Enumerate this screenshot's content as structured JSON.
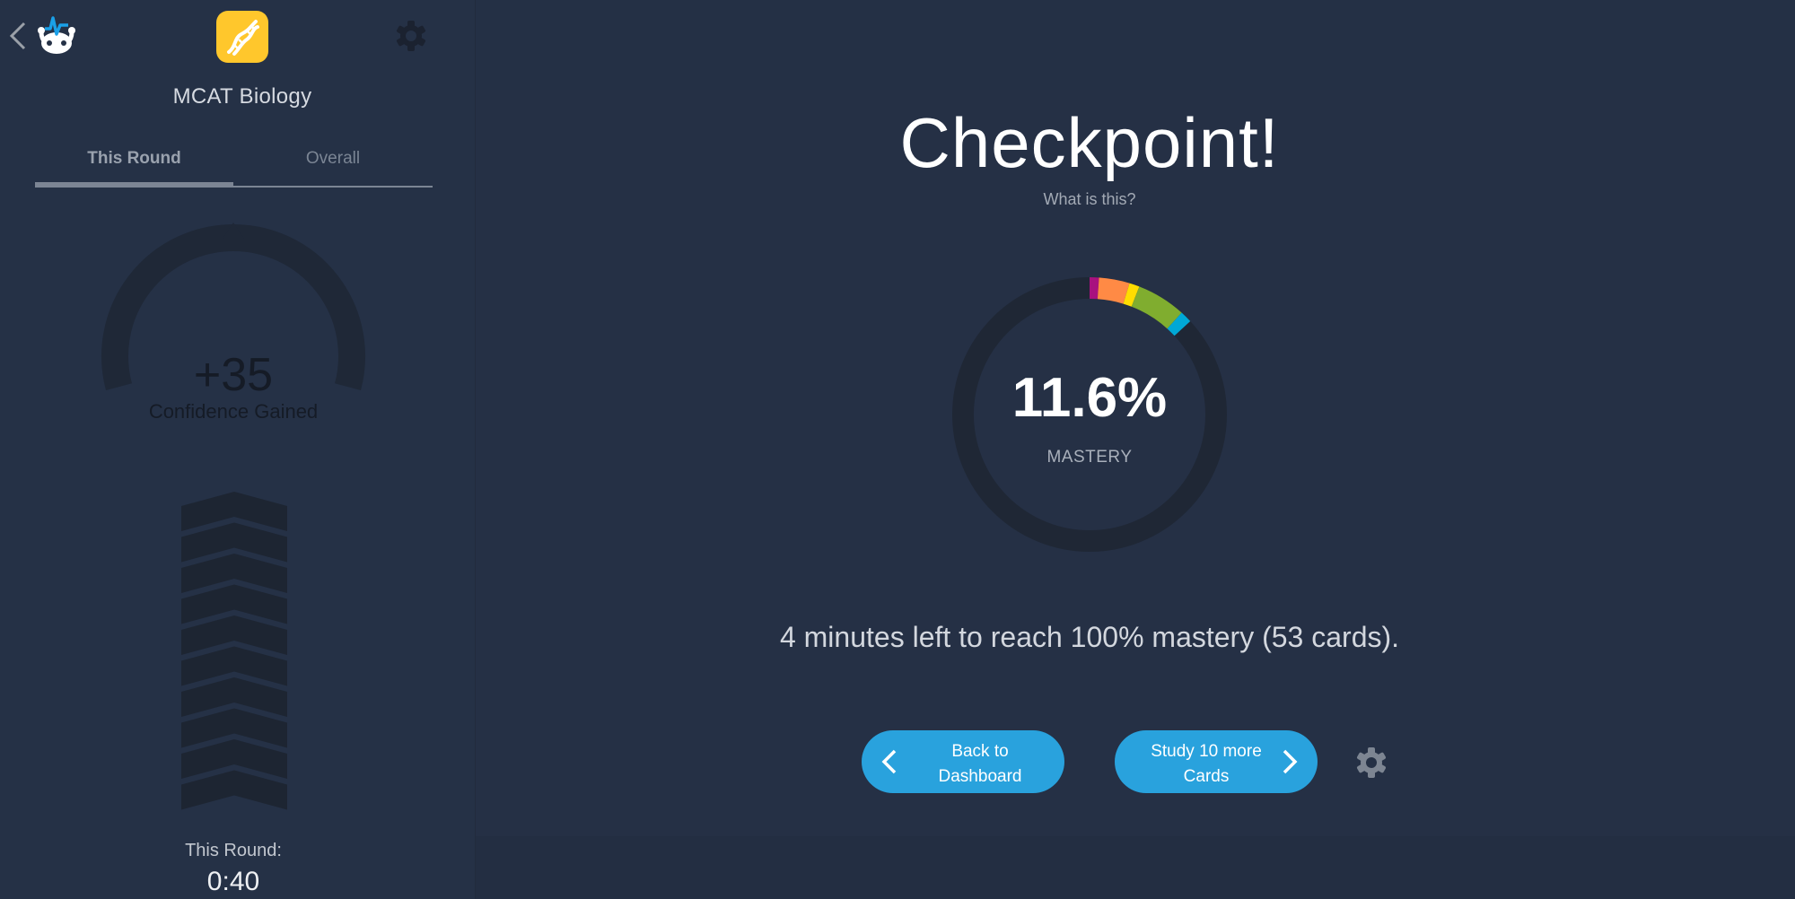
{
  "sidebar": {
    "back_icon": "chevron-left-icon",
    "logo_icon": "brain-logo-icon",
    "deck_icon": "dna-icon",
    "settings_icon": "gear-icon",
    "deck_title": "MCAT Biology",
    "tabs": [
      {
        "label": "This Round",
        "active": true
      },
      {
        "label": "Overall",
        "active": false
      }
    ],
    "confidence_gauge": {
      "value": "+35",
      "label": "Confidence Gained"
    },
    "progress_chevrons": {
      "count": 10,
      "filled": 0
    },
    "round_time": {
      "label": "This Round:",
      "value": "0:40"
    }
  },
  "main": {
    "title": "Checkpoint!",
    "help_link": "What is this?",
    "mastery": {
      "value": "11.6%",
      "label": "MASTERY",
      "segments": [
        {
          "level": 1,
          "color": "#a8117f",
          "fraction": 0.011
        },
        {
          "level": 2,
          "color": "#ff8a45",
          "fraction": 0.036
        },
        {
          "level": 3,
          "color": "#ffdd00",
          "fraction": 0.012
        },
        {
          "level": 4,
          "color": "#80ad2f",
          "fraction": 0.058
        },
        {
          "level": 5,
          "color": "#00a8d6",
          "fraction": 0.014
        }
      ],
      "track_color": "#1f2735"
    },
    "remaining_text": "4 minutes left to reach 100% mastery (53 cards).",
    "buttons": {
      "back": {
        "line1": "Back to",
        "line2": "Dashboard",
        "icon": "chevron-left-icon"
      },
      "study": {
        "line1": "Study 10 more",
        "line2": "Cards",
        "icon": "chevron-right-icon"
      },
      "settings_icon": "gear-icon"
    },
    "colors": {
      "accent": "#29a2dd",
      "background": "#253045",
      "deck_yellow": "#FFC72C"
    }
  }
}
